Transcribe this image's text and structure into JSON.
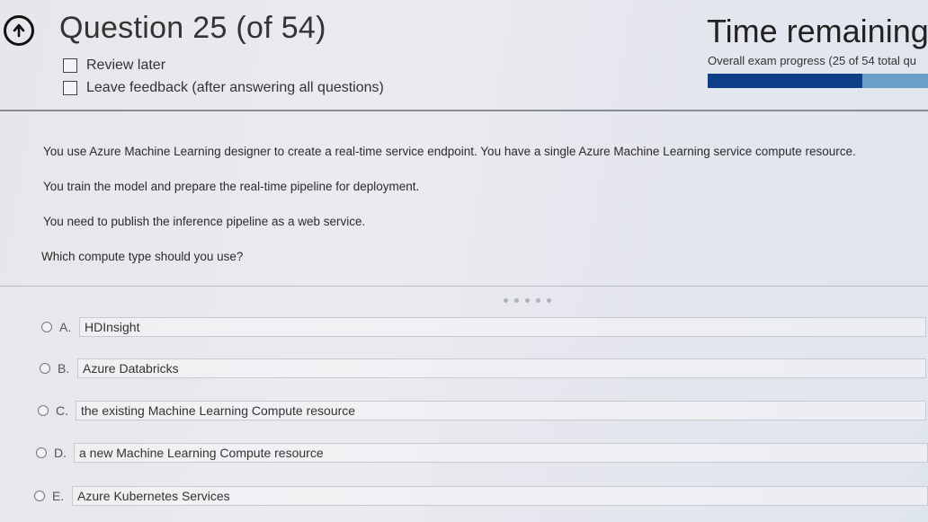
{
  "header": {
    "title": "Question 25 (of 54)",
    "review_later": "Review later",
    "leave_feedback": "Leave feedback (after answering all questions)",
    "time_remaining": "Time remaining",
    "progress_label": "Overall exam progress (25 of 54 total qu",
    "progress_fraction": 0.703,
    "colors": {
      "progress_fill": "#0f3f86",
      "progress_track": "#6ba0c8"
    },
    "icons": {
      "back": "back-arrow-circle-icon"
    }
  },
  "question": {
    "lines": [
      "You use Azure Machine Learning designer to create a real-time service endpoint. You have a single Azure Machine Learning service compute resource.",
      "You train the model and prepare the real-time pipeline for deployment.",
      "You need to publish the inference pipeline as a web service.",
      "Which compute type should you use?"
    ]
  },
  "options": [
    {
      "letter": "A.",
      "text": "HDInsight"
    },
    {
      "letter": "B.",
      "text": "Azure Databricks"
    },
    {
      "letter": "C.",
      "text": "the existing Machine Learning Compute resource"
    },
    {
      "letter": "D.",
      "text": "a new Machine Learning Compute resource"
    },
    {
      "letter": "E.",
      "text": "Azure Kubernetes Services"
    }
  ]
}
